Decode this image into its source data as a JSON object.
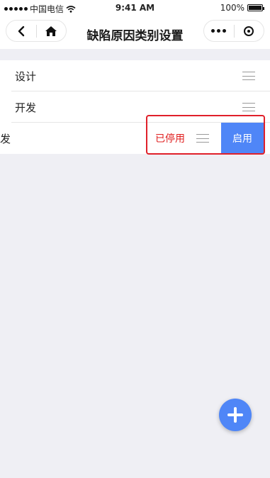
{
  "status_bar": {
    "carrier": "中国电信",
    "time": "9:41 AM",
    "battery": "100%",
    "icons": [
      "signal-dots-icon",
      "wifi-icon",
      "battery-icon"
    ]
  },
  "navbar": {
    "title": "缺陷原因类别设置",
    "icons": [
      "back-icon",
      "home-icon",
      "more-icon",
      "target-icon"
    ]
  },
  "list": {
    "items": [
      {
        "label": "设计"
      },
      {
        "label": "开发"
      },
      {
        "label": "发",
        "status": "已停用",
        "action_label": "启用"
      }
    ]
  },
  "fab": {
    "icon": "plus-icon"
  },
  "colors": {
    "accent": "#4f86f7",
    "disabled_status": "#e02020",
    "highlight_border": "#e0202a",
    "background": "#efeff4"
  }
}
